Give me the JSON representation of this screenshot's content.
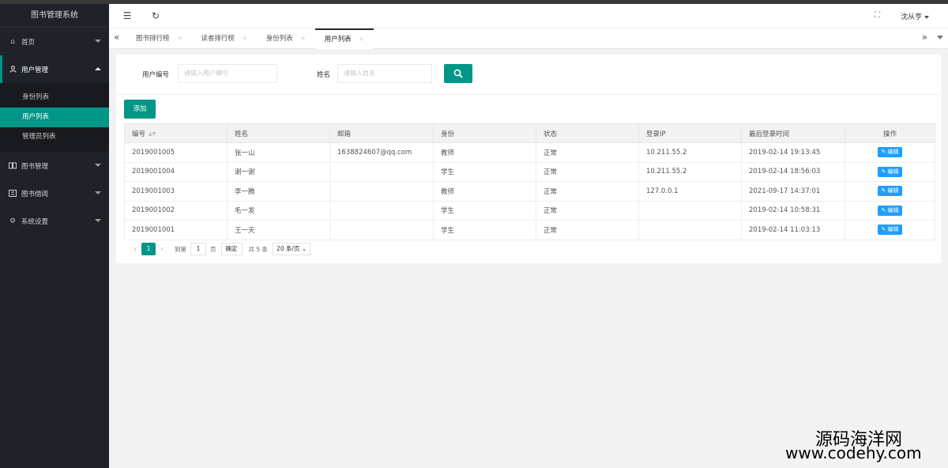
{
  "app": {
    "title": "图书管理系统"
  },
  "sidebar": {
    "items": [
      {
        "label": "首页",
        "icon": "home-icon"
      },
      {
        "label": "用户管理",
        "icon": "user-icon",
        "open": true,
        "children": [
          {
            "label": "身份列表"
          },
          {
            "label": "用户列表",
            "active": true
          },
          {
            "label": "管理员列表"
          }
        ]
      },
      {
        "label": "图书管理",
        "icon": "book-icon"
      },
      {
        "label": "图书借阅",
        "icon": "borrow-icon"
      },
      {
        "label": "系统设置",
        "icon": "gear-icon"
      }
    ]
  },
  "header": {
    "user": "沈从亨"
  },
  "tabs": [
    {
      "label": "图书排行榜"
    },
    {
      "label": "读者排行榜"
    },
    {
      "label": "身份列表"
    },
    {
      "label": "用户列表",
      "active": true
    }
  ],
  "search": {
    "user_no_label": "用户编号",
    "user_no_placeholder": "请输入用户编号",
    "name_label": "姓名",
    "name_placeholder": "请输入姓名"
  },
  "toolbar": {
    "add_label": "添加"
  },
  "table": {
    "columns": [
      "编号",
      "姓名",
      "邮箱",
      "身份",
      "状态",
      "登录IP",
      "最后登录时间",
      "操作"
    ],
    "rows": [
      {
        "id": "2019001005",
        "name": "张一山",
        "email": "1638824607@qq.com",
        "role": "教师",
        "status": "正常",
        "ip": "10.211.55.2",
        "last_login": "2019-02-14 19:13:45",
        "action": "编辑"
      },
      {
        "id": "2019001004",
        "name": "谢一谢",
        "email": "",
        "role": "学生",
        "status": "正常",
        "ip": "10.211.55.2",
        "last_login": "2019-02-14 18:56:03",
        "action": "编辑"
      },
      {
        "id": "2019001003",
        "name": "李一腾",
        "email": "",
        "role": "教师",
        "status": "正常",
        "ip": "127.0.0.1",
        "last_login": "2021-09-17 14:37:01",
        "action": "编辑"
      },
      {
        "id": "2019001002",
        "name": "毛一发",
        "email": "",
        "role": "学生",
        "status": "正常",
        "ip": "",
        "last_login": "2019-02-14 10:58:31",
        "action": "编辑"
      },
      {
        "id": "2019001001",
        "name": "王一天",
        "email": "",
        "role": "学生",
        "status": "正常",
        "ip": "",
        "last_login": "2019-02-14 11:03:13",
        "action": "编辑"
      }
    ]
  },
  "pager": {
    "current": "1",
    "goto_label": "到第",
    "goto_value": "1",
    "page_unit": "页",
    "confirm": "确定",
    "total": "共 5 条",
    "page_size": "20 条/页"
  },
  "watermark": {
    "cn": "源码海洋网",
    "en": "www.codehy.com"
  }
}
